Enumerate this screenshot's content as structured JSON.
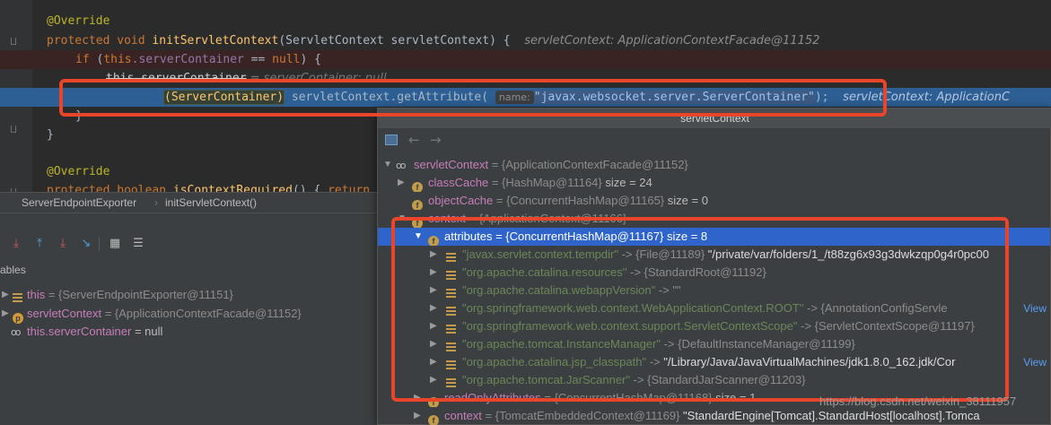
{
  "editor": {
    "lines": {
      "l1_annotation": "@Override",
      "l2_protected": "protected",
      "l2_void": "void",
      "l2_method": "initServletContext",
      "l2_params": "(ServletContext servletContext) {",
      "l2_hint": "servletContext: ApplicationContextFacade@11152",
      "l3_if": "if",
      "l3_open": "(",
      "l3_this": "this",
      "l3_field": ".serverContainer",
      "l3_rest": " == ",
      "l3_null": "null",
      "l3_close": ") {",
      "l4_this": "this",
      "l4_struck": ".serverContainer",
      "l4_hint": " = serverContainer: null",
      "l5_cast": "(ServerContainer)",
      "l5_obj": "servletContext",
      "l5_call": ".getAttribute(",
      "l5_param_name": "name:",
      "l5_arg": "\"javax.websocket.server.ServerContainer\"",
      "l5_end": ");",
      "l5_hint": "servletContext: ApplicationC",
      "l6_brace": "}",
      "l7_brace": "}",
      "l9_annotation": "@Override",
      "l10_protected": "protected",
      "l10_boolean": "boolean",
      "l10_method": "isContextRequired",
      "l10_rest": "() {",
      "l10_return": "return"
    }
  },
  "breadcrumb": {
    "class_name": "ServerEndpointExporter",
    "separator": "›",
    "method_name": "initServletContext()"
  },
  "debug": {
    "variables_label": "ables",
    "vars": [
      {
        "name": "this",
        "value": " = {ServerEndpointExporter@11151}"
      },
      {
        "name": "servletContext",
        "value": " = {ApplicationContextFacade@11152}"
      },
      {
        "name": "this.serverContainer",
        "value": " = null"
      }
    ]
  },
  "popup": {
    "title": "servletContext",
    "back_icon": "←",
    "forward_icon": "→",
    "rows": [
      {
        "name": "servletContext",
        "value": " = {ApplicationContextFacade@11152}"
      },
      {
        "name": "classCache",
        "value": " = {HashMap@11164}",
        "extra": "  size = 24"
      },
      {
        "name": "objectCache",
        "value": " = {ConcurrentHashMap@11165}",
        "extra": "  size = 0"
      },
      {
        "name": "context",
        "value": " = {ApplicationContext@11166}"
      },
      {
        "name": "attributes",
        "value": " = {ConcurrentHashMap@11167}",
        "extra": "  size = 8"
      },
      {
        "key": "\"javax.servlet.context.tempdir\"",
        "value": " -> {File@11189}",
        "strv": " \"/private/var/folders/1_/t88zg6x93g3dwkzqp0g4r0pc00"
      },
      {
        "key": "\"org.apache.catalina.resources\"",
        "value": " -> {StandardRoot@11192}",
        "strv": ""
      },
      {
        "key": "\"org.apache.catalina.webappVersion\"",
        "value": " -> \"\"",
        "strv": ""
      },
      {
        "key": "\"org.springframework.web.context.WebApplicationContext.ROOT\"",
        "value": " -> {AnnotationConfigServle",
        "strv": "",
        "link": "View"
      },
      {
        "key": "\"org.springframework.web.context.support.ServletContextScope\"",
        "value": " -> {ServletContextScope@11197}",
        "strv": ""
      },
      {
        "key": "\"org.apache.tomcat.InstanceManager\"",
        "value": " -> {DefaultInstanceManager@11199}",
        "strv": ""
      },
      {
        "key": "\"org.apache.catalina.jsp_classpath\"",
        "value": " -> ",
        "strv": "\"/Library/Java/JavaVirtualMachines/jdk1.8.0_162.jdk/Cor",
        "link": "View"
      },
      {
        "key": "\"org.apache.tomcat.JarScanner\"",
        "value": " -> {StandardJarScanner@11203}",
        "strv": ""
      },
      {
        "name": "readOnlyAttributes",
        "value": " = {ConcurrentHashMap@11168}",
        "extra": "  size = 1"
      },
      {
        "name": "context",
        "value": " = {TomcatEmbeddedContext@11169}",
        "strv": " \"StandardEngine[Tomcat].StandardHost[localhost].Tomca"
      }
    ]
  },
  "watermark": "https://blog.csdn.net/weixin_38111957",
  "colors": {
    "annotation_box": "#e8452a",
    "selection": "#2f65ca",
    "exec_line": "#2d5f94"
  }
}
